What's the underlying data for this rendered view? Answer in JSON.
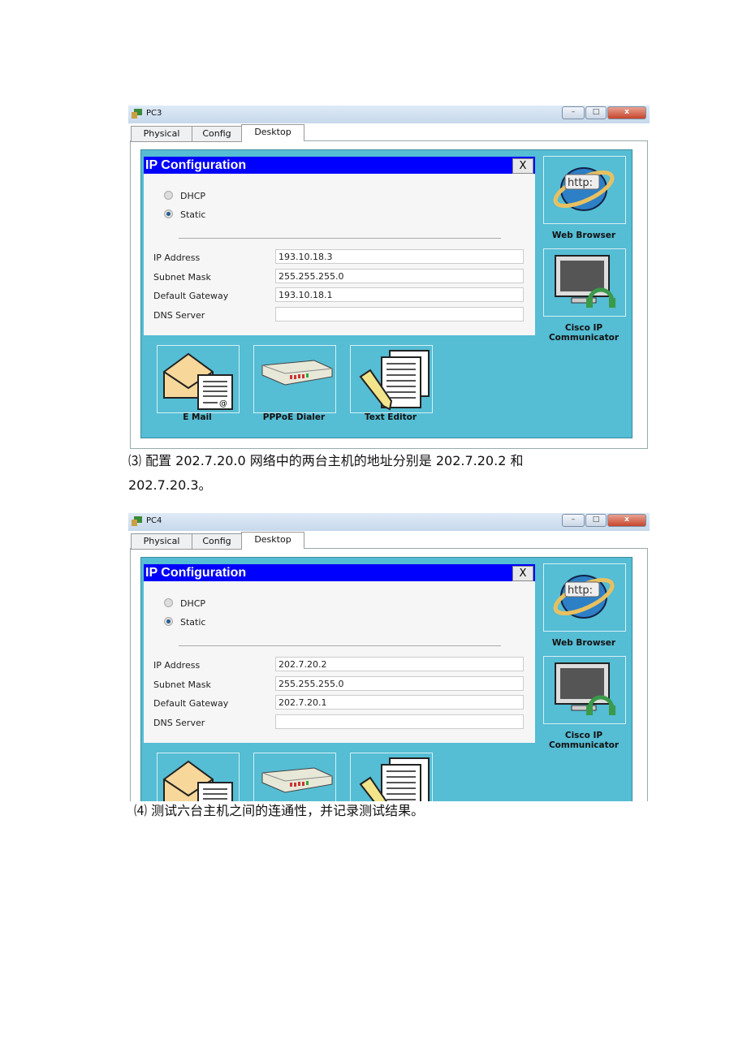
{
  "windows": [
    {
      "title": "PC3",
      "tabs": [
        "Physical",
        "Config",
        "Desktop"
      ],
      "active_tab": "Desktop",
      "dialog": {
        "title": "IP Configuration",
        "close": "X",
        "modes": [
          "DHCP",
          "Static"
        ],
        "selected_mode": "Static",
        "fields": [
          {
            "label": "IP Address",
            "value": "193.10.18.3"
          },
          {
            "label": "Subnet Mask",
            "value": "255.255.255.0"
          },
          {
            "label": "Default Gateway",
            "value": "193.10.18.1"
          },
          {
            "label": "DNS Server",
            "value": ""
          }
        ]
      },
      "apps": {
        "web_browser": "Web Browser",
        "cisco_ip_1": "Cisco IP",
        "cisco_ip_2": "Communicator",
        "email": "E Mail",
        "pppoe": "PPPoE Dialer",
        "text_editor": "Text Editor"
      }
    },
    {
      "title": "PC4",
      "tabs": [
        "Physical",
        "Config",
        "Desktop"
      ],
      "active_tab": "Desktop",
      "dialog": {
        "title": "IP Configuration",
        "close": "X",
        "modes": [
          "DHCP",
          "Static"
        ],
        "selected_mode": "Static",
        "fields": [
          {
            "label": "IP Address",
            "value": "202.7.20.2"
          },
          {
            "label": "Subnet Mask",
            "value": "255.255.255.0"
          },
          {
            "label": "Default Gateway",
            "value": "202.7.20.1"
          },
          {
            "label": "DNS Server",
            "value": ""
          }
        ]
      },
      "apps": {
        "web_browser": "Web Browser",
        "cisco_ip_1": "Cisco IP",
        "cisco_ip_2": "Communicator",
        "email": "",
        "pppoe": "",
        "text_editor": ""
      }
    }
  ],
  "text": {
    "step3_line1": "⑶ 配置 202.7.20.0 网络中的两台主机的地址分别是 202.7.20.2 和",
    "step3_line2": "202.7.20.3。",
    "step4": "⑷ 测试六台主机之间的连通性，并记录测试结果。"
  },
  "colors": {
    "panel": "#55bdd4",
    "dialog_title": "#0000fe"
  }
}
